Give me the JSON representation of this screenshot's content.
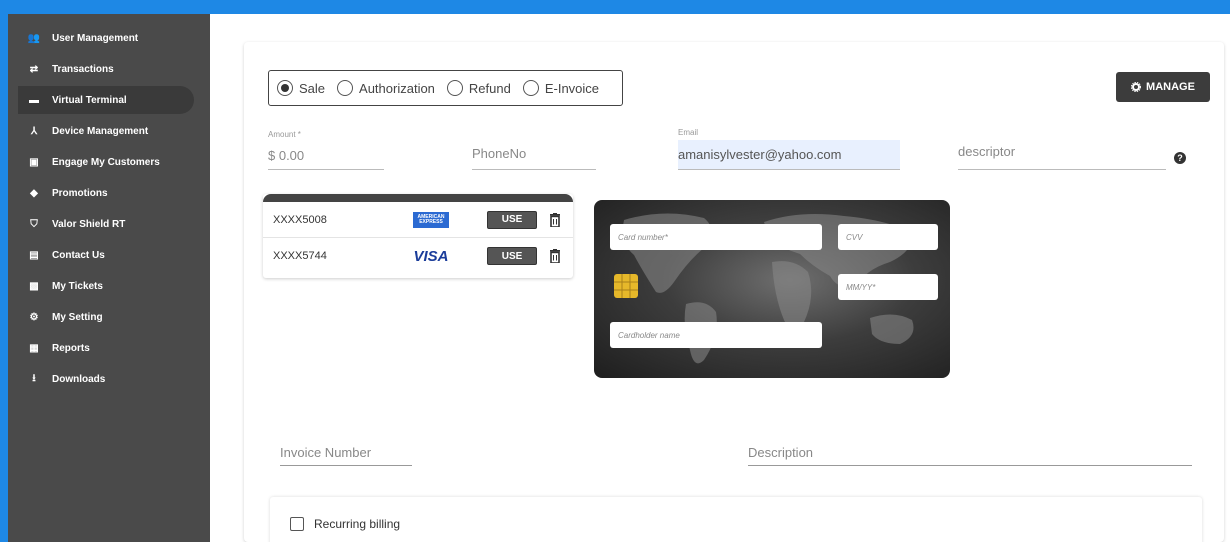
{
  "sidebar": {
    "items": [
      {
        "label": "User Management",
        "icon": "people-icon",
        "glyph": "👥"
      },
      {
        "label": "Transactions",
        "icon": "swap-arrows-icon",
        "glyph": "⇄"
      },
      {
        "label": "Virtual Terminal",
        "icon": "terminal-icon",
        "glyph": "▬"
      },
      {
        "label": "Device Management",
        "icon": "device-tree-icon",
        "glyph": "⅄"
      },
      {
        "label": "Engage My Customers",
        "icon": "contact-card-icon",
        "glyph": "▣"
      },
      {
        "label": "Promotions",
        "icon": "tag-icon",
        "glyph": "◆"
      },
      {
        "label": "Valor Shield RT",
        "icon": "shield-icon",
        "glyph": "⛉"
      },
      {
        "label": "Contact Us",
        "icon": "contact-book-icon",
        "glyph": "▤"
      },
      {
        "label": "My Tickets",
        "icon": "ticket-icon",
        "glyph": "▩"
      },
      {
        "label": "My Setting",
        "icon": "settings-icon",
        "glyph": "⚙"
      },
      {
        "label": "Reports",
        "icon": "report-icon",
        "glyph": "▦"
      },
      {
        "label": "Downloads",
        "icon": "download-icon",
        "glyph": "⭳"
      }
    ],
    "active_index": 2
  },
  "transaction_types": {
    "options": [
      "Sale",
      "Authorization",
      "Refund",
      "E-Invoice"
    ],
    "selected": "Sale"
  },
  "manage_button": {
    "label": "MANAGE",
    "icon": "gear-icon"
  },
  "form": {
    "amount": {
      "label": "Amount *",
      "value": "$ 0.00"
    },
    "phone": {
      "placeholder": "PhoneNo"
    },
    "email": {
      "label": "Email",
      "value": "amanisylvester@yahoo.com"
    },
    "descriptor": {
      "placeholder": "descriptor"
    }
  },
  "saved_cards": [
    {
      "masked": "XXXX5008",
      "brand": "American Express",
      "brand_short": "AMERICAN EXPRESS",
      "use_label": "USE"
    },
    {
      "masked": "XXXX5744",
      "brand": "VISA",
      "brand_short": "VISA",
      "use_label": "USE"
    }
  ],
  "card_form": {
    "card_number": "Card number*",
    "cvv": "CVV",
    "expiry": "MM/YY*",
    "cardholder": "Cardholder name"
  },
  "invoice": {
    "placeholder": "Invoice Number"
  },
  "description": {
    "placeholder": "Description"
  },
  "recurring": {
    "label": "Recurring billing",
    "checked": false
  },
  "colors": {
    "accent_border": "#1e88e5",
    "sidebar_bg": "#4a4a4a",
    "button_dark": "#3c3c3c",
    "email_autofill": "#e8f0fe"
  }
}
